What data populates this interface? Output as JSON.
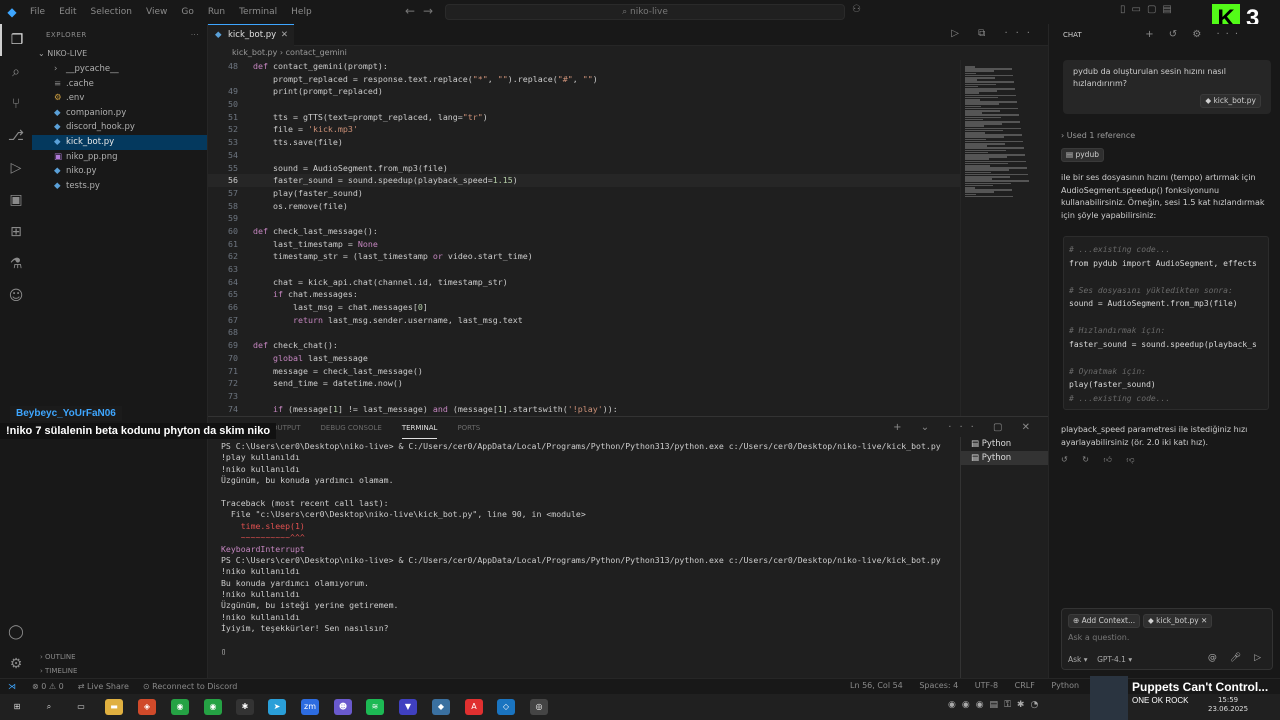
{
  "titlebar": {
    "menu": [
      "File",
      "Edit",
      "Selection",
      "View",
      "Go",
      "Run",
      "Terminal",
      "Help"
    ],
    "search": "niko-live",
    "badge_number": "3"
  },
  "explorer": {
    "header": "EXPLORER",
    "root": "NIKO-LIVE",
    "files": [
      {
        "name": "__pycache__",
        "icon": "chevron-right-icon"
      },
      {
        "name": ".cache",
        "icon": "file-icon"
      },
      {
        "name": ".env",
        "icon": "gear-icon"
      },
      {
        "name": "companion.py",
        "icon": "python-icon"
      },
      {
        "name": "discord_hook.py",
        "icon": "python-icon"
      },
      {
        "name": "kick_bot.py",
        "icon": "python-icon"
      },
      {
        "name": "niko_pp.png",
        "icon": "image-icon"
      },
      {
        "name": "niko.py",
        "icon": "python-icon"
      },
      {
        "name": "tests.py",
        "icon": "python-icon"
      }
    ],
    "outline": "OUTLINE",
    "timeline": "TIMELINE"
  },
  "editor": {
    "tab": "kick_bot.py",
    "breadcrumb_file": "kick_bot.py",
    "breadcrumb_symbol": "contact_gemini",
    "lines": [
      {
        "n": "48",
        "t": "def contact_gemini(prompt):"
      },
      {
        "n": "",
        "t": "    prompt_replaced = response.text.replace(\"*\", \"\").replace(\"#\", \"\")"
      },
      {
        "n": "49",
        "t": "    print(prompt_replaced)"
      },
      {
        "n": "50",
        "t": ""
      },
      {
        "n": "51",
        "t": "    tts = gTTS(text=prompt_replaced, lang=\"tr\")"
      },
      {
        "n": "52",
        "t": "    file = 'kick.mp3'"
      },
      {
        "n": "53",
        "t": "    tts.save(file)"
      },
      {
        "n": "54",
        "t": ""
      },
      {
        "n": "55",
        "t": "    sound = AudioSegment.from_mp3(file)"
      },
      {
        "n": "56",
        "t": "    faster_sound = sound.speedup(playback_speed=1.15)"
      },
      {
        "n": "57",
        "t": "    play(faster_sound)"
      },
      {
        "n": "58",
        "t": "    os.remove(file)"
      },
      {
        "n": "59",
        "t": ""
      },
      {
        "n": "60",
        "t": "def check_last_message():"
      },
      {
        "n": "61",
        "t": "    last_timestamp = None"
      },
      {
        "n": "62",
        "t": "    timestamp_str = (last_timestamp or video.start_time)"
      },
      {
        "n": "63",
        "t": ""
      },
      {
        "n": "64",
        "t": "    chat = kick_api.chat(channel.id, timestamp_str)"
      },
      {
        "n": "65",
        "t": "    if chat.messages:"
      },
      {
        "n": "66",
        "t": "        last_msg = chat.messages[0]"
      },
      {
        "n": "67",
        "t": "        return last_msg.sender.username, last_msg.text"
      },
      {
        "n": "68",
        "t": ""
      },
      {
        "n": "69",
        "t": "def check_chat():"
      },
      {
        "n": "70",
        "t": "    global last_message"
      },
      {
        "n": "71",
        "t": "    message = check_last_message()"
      },
      {
        "n": "72",
        "t": "    send_time = datetime.now()"
      },
      {
        "n": "73",
        "t": ""
      },
      {
        "n": "74",
        "t": "    if (message[1] != last_message) and (message[1].startswith('!play')):"
      }
    ],
    "current_line": "56"
  },
  "panel": {
    "tabs": [
      "OUTPUT",
      "DEBUG CONSOLE",
      "TERMINAL",
      "PORTS"
    ],
    "active_tab": "TERMINAL",
    "terminal_lines": [
      "PS C:\\Users\\cer0\\Desktop\\niko-live> & C:/Users/cer0/AppData/Local/Programs/Python/Python313/python.exe c:/Users/cer0/Desktop/niko-live/kick_bot.py",
      "!play kullanıldı",
      "!niko kullanıldı",
      "Üzgünüm, bu konuda yardımcı olamam.",
      "",
      "Traceback (most recent call last):",
      "  File \"c:\\Users\\cer0\\Desktop\\niko-live\\kick_bot.py\", line 90, in <module>",
      "    time.sleep(1)",
      "    ~~~~~~~~~~^^^",
      "KeyboardInterrupt",
      "PS C:\\Users\\cer0\\Desktop\\niko-live> & C:/Users/cer0/AppData/Local/Programs/Python/Python313/python.exe c:/Users/cer0/Desktop/niko-live/kick_bot.py",
      "!niko kullanıldı",
      "Bu konuda yardımcı olamıyorum.",
      "!niko kullanıldı",
      "Üzgünüm, bu isteği yerine getiremem.",
      "!niko kullanıldı",
      "İyiyim, teşekkürler! Sen nasılsın?",
      "",
      "▯"
    ],
    "terminal_list": [
      "Python",
      "Python"
    ]
  },
  "overlay": {
    "username": "Beybeyc_YoUrFaN06",
    "message": "!niko 7 sülalenin beta kodunu phyton da skim niko"
  },
  "chat": {
    "header": "CHAT",
    "user_question": "pydub da oluşturulan sesin hızını nasıl hızlandırırım?",
    "file_chip": "kick_bot.py",
    "used_reference": "Used 1 reference",
    "ref_chip": "pydub",
    "answer_intro": "ile bir ses dosyasının hızını (tempo) artırmak için AudioSegment.speedup() fonksiyonunu kullanabilirsiniz. Örneğin, sesi 1.5 kat hızlandırmak için şöyle yapabilirsiniz:",
    "code_lines": [
      {
        "t": "# ...existing code...",
        "c": true
      },
      {
        "t": "from pydub import AudioSegment, effects",
        "c": false
      },
      {
        "t": "",
        "c": false
      },
      {
        "t": "# Ses dosyasını yükledikten sonra:",
        "c": true
      },
      {
        "t": "sound = AudioSegment.from_mp3(file)",
        "c": false
      },
      {
        "t": "",
        "c": false
      },
      {
        "t": "# Hızlandırmak için:",
        "c": true
      },
      {
        "t": "faster_sound = sound.speedup(playback_s",
        "c": false
      },
      {
        "t": "",
        "c": false
      },
      {
        "t": "# Oynatmak için:",
        "c": true
      },
      {
        "t": "play(faster_sound)",
        "c": false
      },
      {
        "t": "# ...existing code...",
        "c": true
      }
    ],
    "answer_outro": "playback_speed parametresi ile istediğiniz hızı ayarlayabilirsiniz (ör. 2.0 iki katı hız).",
    "add_context": "Add Context...",
    "context_file": "kick_bot.py",
    "ask_placeholder": "Ask a question.",
    "mode": "Ask ▾",
    "model": "GPT-4.1 ▾"
  },
  "statusbar": {
    "left": "⊗ 0 ⚠ 0",
    "live_share": "Live Share",
    "discord": "Reconnect to Discord",
    "position": "Ln 56, Col 54",
    "spaces": "Spaces: 4",
    "encoding": "UTF-8",
    "eol": "CRLF",
    "language": "Python"
  },
  "media": {
    "title": "Puppets Can't Control...",
    "artist": "ONE OK ROCK",
    "time": "15:59",
    "date": "23.06.2025"
  }
}
